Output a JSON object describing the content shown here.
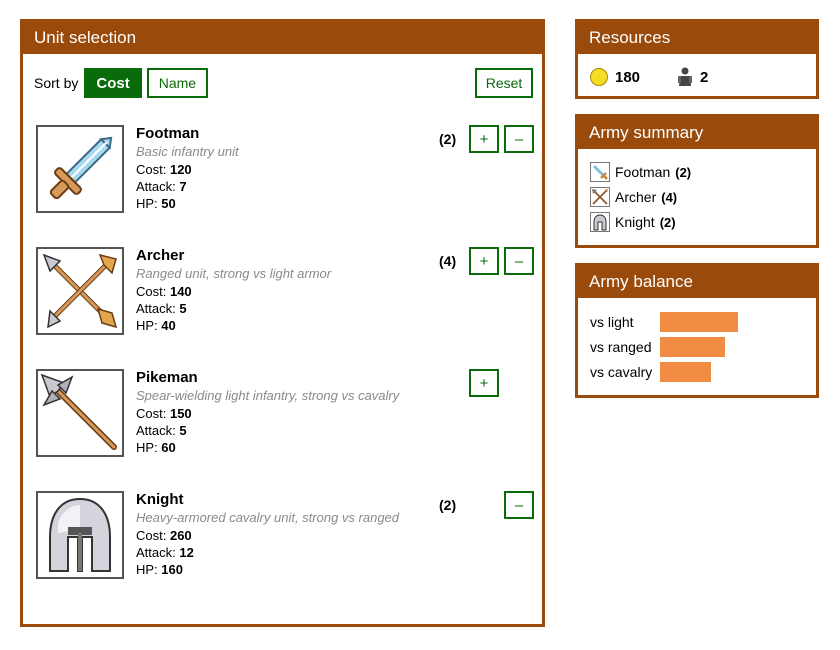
{
  "unit_selection": {
    "title": "Unit selection",
    "sort_label": "Sort by",
    "sort_options": [
      {
        "label": "Cost",
        "active": true
      },
      {
        "label": "Name",
        "active": false
      }
    ],
    "reset_label": "Reset",
    "plus_symbol": "+",
    "minus_symbol": "–",
    "units": [
      {
        "name": "Footman",
        "description": "Basic infantry unit",
        "cost_label": "Cost:",
        "cost": "120",
        "attack_label": "Attack:",
        "attack": "7",
        "hp_label": "HP:",
        "hp": "50",
        "count": "(2)",
        "icon": "sword-icon"
      },
      {
        "name": "Archer",
        "description": "Ranged unit, strong vs light armor",
        "cost_label": "Cost:",
        "cost": "140",
        "attack_label": "Attack:",
        "attack": "5",
        "hp_label": "HP:",
        "hp": "40",
        "count": "(4)",
        "icon": "arrows-icon"
      },
      {
        "name": "Pikeman",
        "description": "Spear-wielding light infantry, strong vs cavalry",
        "cost_label": "Cost:",
        "cost": "150",
        "attack_label": "Attack:",
        "attack": "5",
        "hp_label": "HP:",
        "hp": "60",
        "count": "",
        "icon": "spear-icon"
      },
      {
        "name": "Knight",
        "description": "Heavy-armored cavalry unit, strong vs ranged",
        "cost_label": "Cost:",
        "cost": "260",
        "attack_label": "Attack:",
        "attack": "12",
        "hp_label": "HP:",
        "hp": "160",
        "count": "(2)",
        "icon": "helmet-icon"
      }
    ]
  },
  "resources": {
    "title": "Resources",
    "gold": "180",
    "population": "2",
    "gold_icon": "coin-icon",
    "population_icon": "soldier-icon"
  },
  "army_summary": {
    "title": "Army summary",
    "items": [
      {
        "name": "Footman",
        "count": "(2)",
        "icon": "sword-icon"
      },
      {
        "name": "Archer",
        "count": "(4)",
        "icon": "arrows-icon"
      },
      {
        "name": "Knight",
        "count": "(2)",
        "icon": "helmet-icon"
      }
    ]
  },
  "army_balance": {
    "title": "Army balance",
    "bar_color": "#f08c44",
    "rows": [
      {
        "label": "vs light",
        "value": 0.52
      },
      {
        "label": "vs ranged",
        "value": 0.43
      },
      {
        "label": "vs cavalry",
        "value": 0.34
      }
    ]
  },
  "colors": {
    "panel_brown": "#9a4a0a",
    "button_green": "#0a6b0a"
  }
}
